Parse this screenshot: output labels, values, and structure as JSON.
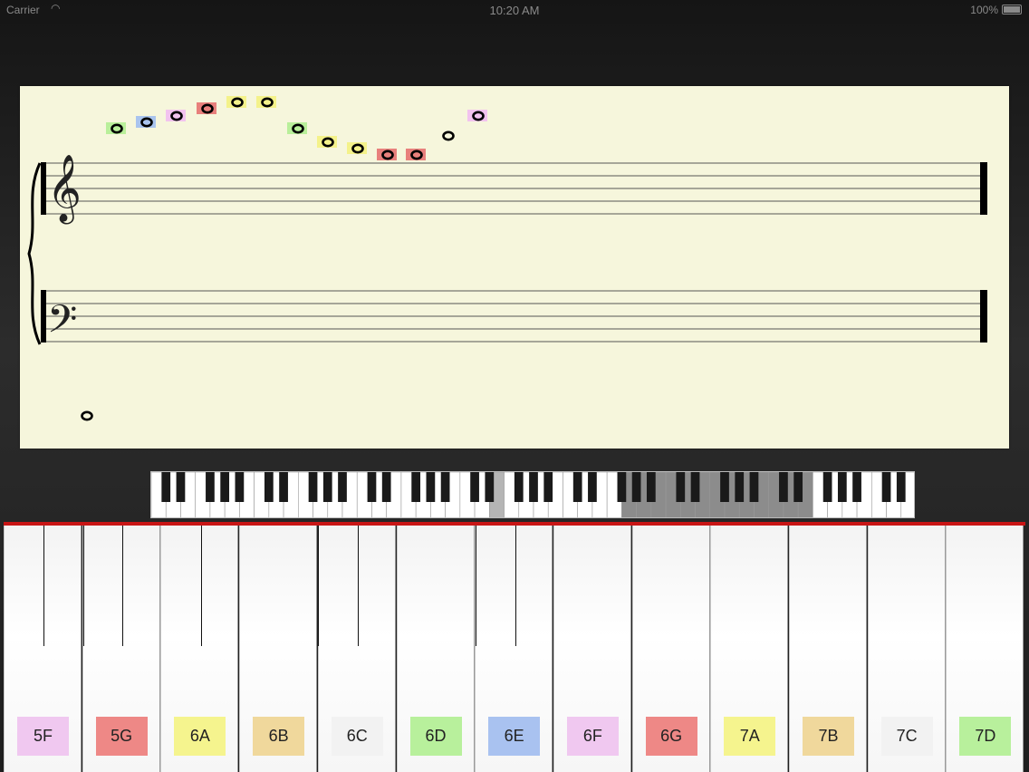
{
  "status_bar": {
    "carrier": "Carrier",
    "time": "10:20 AM",
    "battery": "100%"
  },
  "score": {
    "staves": [
      "treble",
      "bass"
    ],
    "treble_clef": "𝄞",
    "bass_clef": "𝄢",
    "note_count": 14,
    "highlight_colors": [
      "#b9ef9a",
      "#a9c4ee",
      "#f2c3ef",
      "#e8807c",
      "#f4f28a",
      "#efd99a"
    ]
  },
  "mini_keyboard": {
    "visible_range_highlighted": true
  },
  "piano": {
    "keys": [
      {
        "label": "5F",
        "color": "#f0c8f0"
      },
      {
        "label": "5G",
        "color": "#ee8886"
      },
      {
        "label": "6A",
        "color": "#f5f48e"
      },
      {
        "label": "6B",
        "color": "#f0d89c"
      },
      {
        "label": "6C",
        "color": "#f2f2f2"
      },
      {
        "label": "6D",
        "color": "#b8f09c"
      },
      {
        "label": "6E",
        "color": "#a9c2f0"
      },
      {
        "label": "6F",
        "color": "#f0c8f0"
      },
      {
        "label": "6G",
        "color": "#ee8886"
      },
      {
        "label": "7A",
        "color": "#f5f48e"
      },
      {
        "label": "7B",
        "color": "#f0d89c"
      },
      {
        "label": "7C",
        "color": "#f2f2f2"
      },
      {
        "label": "7D",
        "color": "#b8f09c"
      }
    ]
  }
}
